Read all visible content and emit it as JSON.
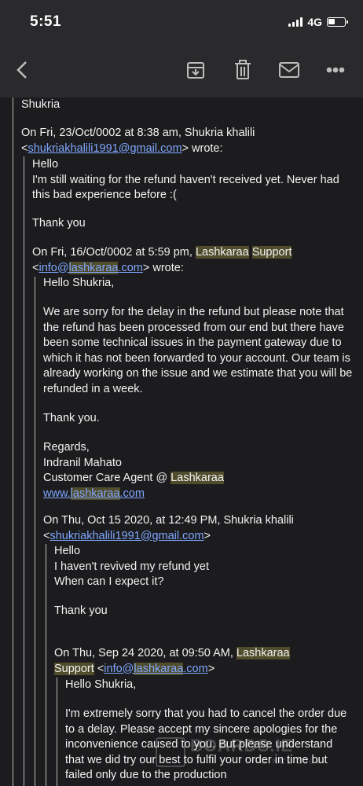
{
  "status_bar": {
    "time": "5:51",
    "network": "4G"
  },
  "toolbar": {
    "icons": [
      "back-icon",
      "archive-icon",
      "trash-icon",
      "mail-icon",
      "more-icon"
    ]
  },
  "email": {
    "signature": "Shukria",
    "reply1": {
      "header_prefix": "On Fri, 23/Oct/0002 at 8:38 am, Shukria khalili",
      "email": "shukriakhalili1991@gmail.com",
      "wrote": "wrote:",
      "greeting": "Hello",
      "body": "I'm still waiting for the refund haven't received yet. Never had this bad experience before :(",
      "thanks": "Thank you"
    },
    "reply2": {
      "header_prefix": "On Fri, 16/Oct/0002 at 5:59 pm,",
      "name1": "Lashkaraa",
      "name2": "Support",
      "email_user": "info@",
      "email_domain_hl": "lashkaraa",
      "email_tld": ".com",
      "wrote": "wrote:",
      "greeting": "Hello Shukria,",
      "body": "We are sorry for the delay in the refund but please note that the refund has been processed from our end but there have been some technical issues in the payment gateway due to which it has not been forwarded to your account. Our team is already working on the issue and we estimate that you will be refunded in a week.",
      "thanks": "Thank you.",
      "regards": "Regards,",
      "agent_name": "Indranil Mahato",
      "agent_title_prefix": "Customer Care Agent @",
      "agent_company": "Lashkaraa",
      "site_prefix": "www.",
      "site_domain": "lashkaraa",
      "site_tld": ".com"
    },
    "reply3": {
      "header": "On Thu, Oct 15 2020, at 12:49 PM, Shukria khalili",
      "email": "shukriakhalili1991@gmail.com",
      "greeting": "Hello",
      "line1": "I haven't revived my refund yet",
      "line2": "When can I expect it?",
      "thanks": "Thank you"
    },
    "reply4": {
      "header_prefix": "On Thu, Sep 24 2020, at 09:50 AM,",
      "name1": "Lashkaraa",
      "name2": "Support",
      "email_user": "info@",
      "email_domain_hl": "lashkaraa",
      "email_tld": ".com",
      "greeting": "Hello Shukria,",
      "body": "I'm extremely sorry that you had to cancel the order due to a delay. Please accept my sincere apologies for the inconvenience caused to you. But please understand that we did try our best to fulfil your order in time but failed only due to the production"
    }
  },
  "watermark": {
    "brand": "BOARDS.IE",
    "since": "SINCE 2004"
  }
}
